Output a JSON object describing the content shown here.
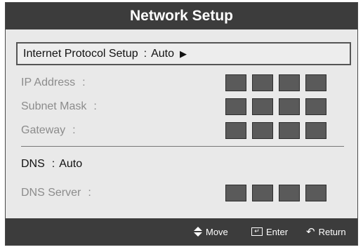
{
  "header": {
    "title": "Network Setup"
  },
  "protocol_row": {
    "label": "Internet Protocol Setup",
    "separator": ":",
    "value": "Auto",
    "arrow_icon": "right-triangle-icon"
  },
  "ip_fields": [
    {
      "label": "IP Address",
      "colon": ":"
    },
    {
      "label": "Subnet Mask",
      "colon": ":"
    },
    {
      "label": "Gateway",
      "colon": ":"
    }
  ],
  "dns": {
    "label": "DNS",
    "colon": ":",
    "value": "Auto"
  },
  "dns_server": {
    "label": "DNS Server",
    "colon": ":"
  },
  "footer": {
    "move_label": "Move",
    "enter_label": "Enter",
    "return_label": "Return"
  },
  "colors": {
    "header_bg": "#3c3c3c",
    "panel_bg": "#e9e9e9",
    "disabled_text": "#8c8c8c",
    "box_fill": "#5a5a5a"
  }
}
